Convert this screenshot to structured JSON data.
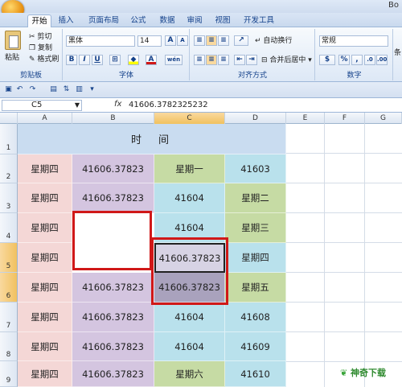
{
  "window": {
    "title": "Bo"
  },
  "tabs": [
    {
      "label": "开始",
      "active": true
    },
    {
      "label": "插入",
      "active": false
    },
    {
      "label": "页面布局",
      "active": false
    },
    {
      "label": "公式",
      "active": false
    },
    {
      "label": "数据",
      "active": false
    },
    {
      "label": "审阅",
      "active": false
    },
    {
      "label": "视图",
      "active": false
    },
    {
      "label": "开发工具",
      "active": false
    }
  ],
  "ribbon": {
    "clipboard": {
      "paste": "粘贴",
      "cut": "剪切",
      "copy": "复制",
      "format_painter": "格式刷",
      "label": "剪贴板"
    },
    "font": {
      "name": "黑体",
      "size": "14",
      "bold": "B",
      "italic": "I",
      "underline": "U",
      "grow": "A",
      "shrink": "A",
      "color": "A",
      "phonetic": "wén",
      "label": "字体"
    },
    "alignment": {
      "wrap": "自动换行",
      "merge": "合并后居中",
      "label": "对齐方式"
    },
    "number": {
      "format": "常规",
      "percent": "%",
      "comma": ",",
      "label": "数字"
    },
    "more": "条"
  },
  "formula_bar": {
    "name_box": "C5",
    "fx": "fx",
    "value": "41606.3782325232"
  },
  "columns": [
    "A",
    "B",
    "C",
    "D",
    "E",
    "F",
    "G"
  ],
  "rows": [
    "1",
    "2",
    "3",
    "4",
    "5",
    "6",
    "7",
    "8",
    "9"
  ],
  "selected_column": "C",
  "selected_rows": [
    "5",
    "6"
  ],
  "sheet": {
    "title": "时　间",
    "rows": [
      [
        "星期四",
        "41606.37823",
        "星期一",
        "41603"
      ],
      [
        "星期四",
        "41606.37823",
        "41604",
        "星期二"
      ],
      [
        "星期四",
        "",
        "41604",
        "星期三"
      ],
      [
        "星期四",
        "",
        "41606.37823",
        "星期四"
      ],
      [
        "星期四",
        "41606.37823",
        "41606.37823",
        "星期五"
      ],
      [
        "星期四",
        "41606.37823",
        "41604",
        "41608"
      ],
      [
        "星期四",
        "41606.37823",
        "41604",
        "41609"
      ],
      [
        "星期四",
        "41606.37823",
        "星期六",
        "41610"
      ]
    ]
  },
  "watermark": "神奇下载"
}
